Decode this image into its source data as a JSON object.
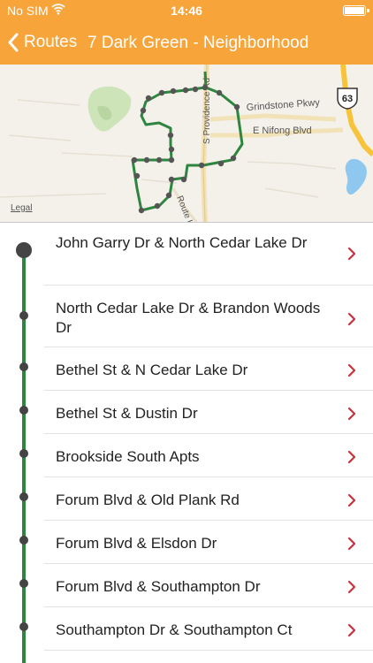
{
  "status_bar": {
    "carrier": "No SIM",
    "time": "14:46"
  },
  "nav": {
    "back_label": "Routes",
    "title": "7 Dark Green - Neighborhood"
  },
  "map": {
    "legal_label": "Legal",
    "road_labels": [
      "Grindstone Pkwy",
      "E Nifong Blvd",
      "S Providence Rd",
      "Route K"
    ],
    "highway_shield": "63",
    "route_color": "#2e8540"
  },
  "stops": [
    {
      "name": "John Garry Dr & North Cedar Lake Dr"
    },
    {
      "name": "North Cedar Lake Dr & Brandon Woods Dr"
    },
    {
      "name": "Bethel St & N Cedar Lake Dr"
    },
    {
      "name": "Bethel St & Dustin Dr"
    },
    {
      "name": "Brookside South Apts"
    },
    {
      "name": "Forum Blvd & Old Plank Rd"
    },
    {
      "name": "Forum Blvd & Elsdon Dr"
    },
    {
      "name": "Forum Blvd & Southampton Dr"
    },
    {
      "name": "Southampton Dr & Southampton Ct"
    }
  ],
  "theme": {
    "header_color": "#f7a53a",
    "chevron_color": "#c8323c",
    "route_line_color": "#2e8540"
  }
}
